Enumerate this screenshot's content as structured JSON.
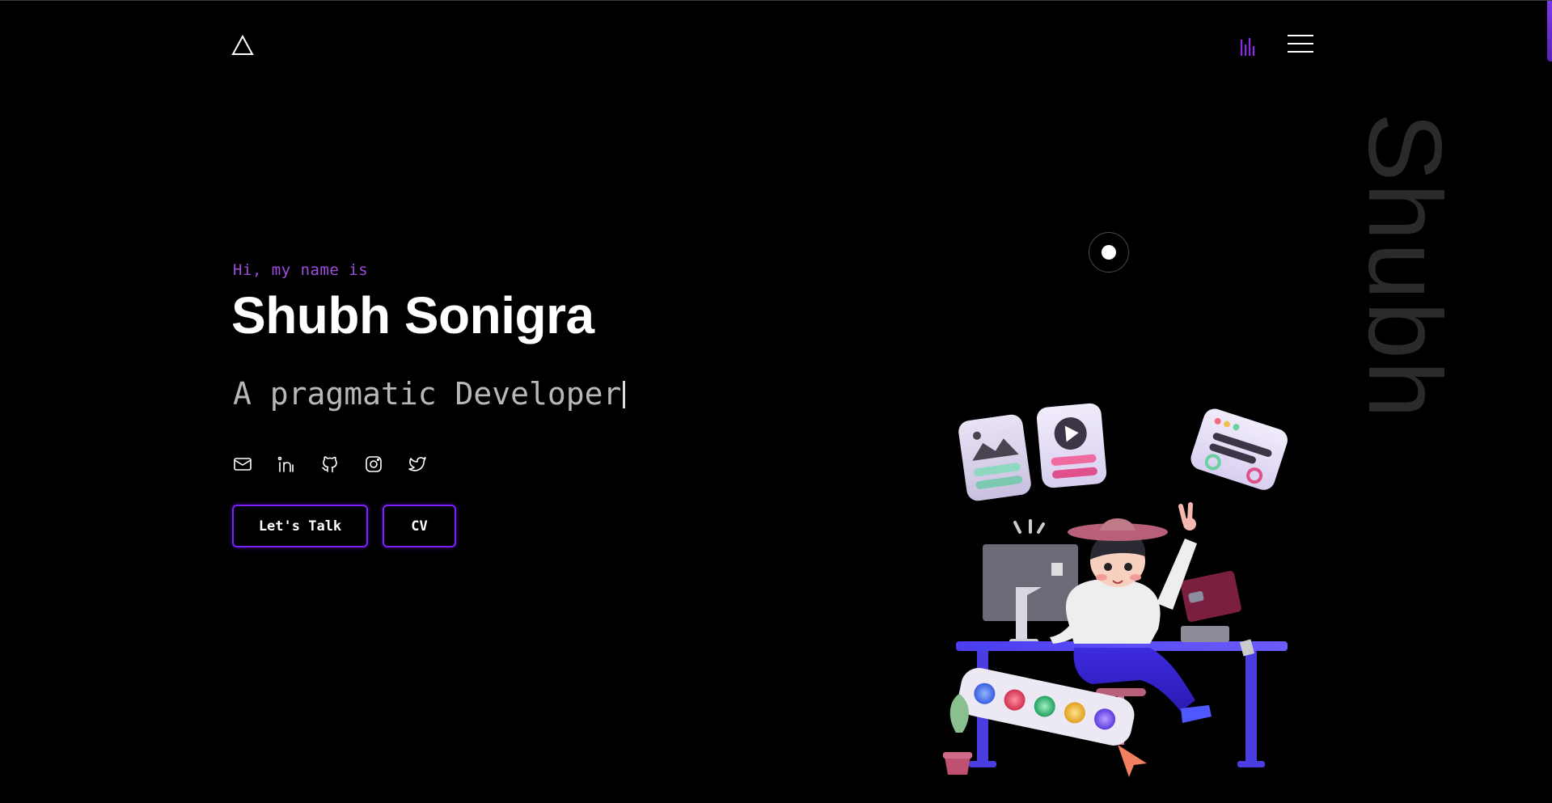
{
  "header": {
    "logo_icon": "triangle-logo-icon",
    "sound_icon": "sound-bars-icon",
    "menu_icon": "hamburger-menu-icon"
  },
  "hero": {
    "greeting": "Hi, my name is",
    "first_name": "Shubh",
    "last_name": "Sonigra",
    "tagline": "A pragmatic Developer",
    "watermark": "Shubh"
  },
  "socials": [
    {
      "icon": "mail-icon"
    },
    {
      "icon": "linkedin-icon"
    },
    {
      "icon": "github-icon"
    },
    {
      "icon": "instagram-icon"
    },
    {
      "icon": "twitter-icon"
    }
  ],
  "buttons": {
    "talk_label": "Let's Talk",
    "cv_label": "CV"
  },
  "colors": {
    "accent": "#7c1fff",
    "greeting": "#9d4edd",
    "background": "#000000"
  }
}
